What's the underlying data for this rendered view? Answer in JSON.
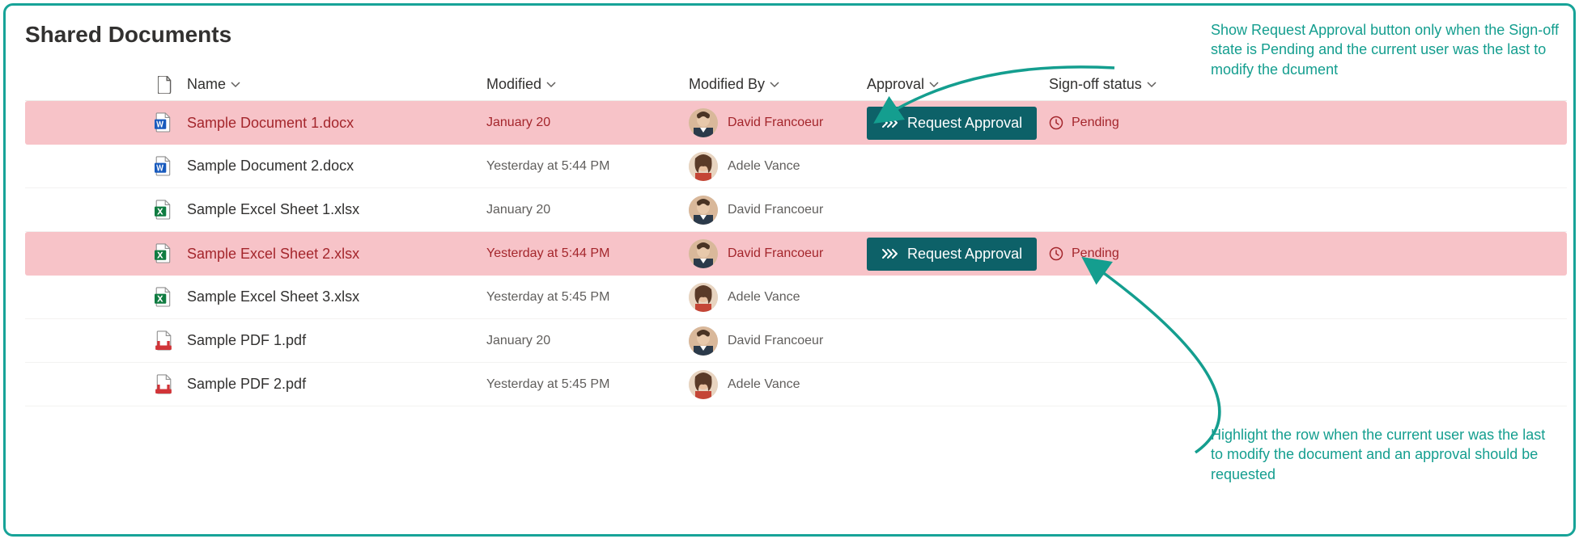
{
  "title": "Shared Documents",
  "columns": {
    "name": "Name",
    "modified": "Modified",
    "modified_by": "Modified By",
    "approval": "Approval",
    "sign_off": "Sign-off status"
  },
  "buttons": {
    "request_approval": "Request Approval"
  },
  "status_labels": {
    "pending": "Pending"
  },
  "annotations": {
    "top": "Show Request Approval button only when the Sign-off state is Pending and the current user was the last to modify the dcument",
    "bottom": "Highlight the row when the current user was the last to modify the document and an approval should be requested"
  },
  "rows": [
    {
      "file_type": "docx",
      "name": "Sample Document 1.docx",
      "modified": "January 20",
      "modified_by": "David Francoeur",
      "avatar": "david",
      "highlight": true,
      "show_approval_button": true,
      "sign_off": "pending"
    },
    {
      "file_type": "docx",
      "name": "Sample Document 2.docx",
      "modified": "Yesterday at 5:44 PM",
      "modified_by": "Adele Vance",
      "avatar": "adele",
      "highlight": false,
      "show_approval_button": false,
      "sign_off": null
    },
    {
      "file_type": "xlsx",
      "name": "Sample Excel Sheet 1.xlsx",
      "modified": "January 20",
      "modified_by": "David Francoeur",
      "avatar": "david",
      "highlight": false,
      "show_approval_button": false,
      "sign_off": null
    },
    {
      "file_type": "xlsx",
      "name": "Sample Excel Sheet 2.xlsx",
      "modified": "Yesterday at 5:44 PM",
      "modified_by": "David Francoeur",
      "avatar": "david",
      "highlight": true,
      "show_approval_button": true,
      "sign_off": "pending"
    },
    {
      "file_type": "xlsx",
      "name": "Sample Excel Sheet 3.xlsx",
      "modified": "Yesterday at 5:45 PM",
      "modified_by": "Adele Vance",
      "avatar": "adele",
      "highlight": false,
      "show_approval_button": false,
      "sign_off": null
    },
    {
      "file_type": "pdf",
      "name": "Sample PDF 1.pdf",
      "modified": "January 20",
      "modified_by": "David Francoeur",
      "avatar": "david",
      "highlight": false,
      "show_approval_button": false,
      "sign_off": null
    },
    {
      "file_type": "pdf",
      "name": "Sample PDF 2.pdf",
      "modified": "Yesterday at 5:45 PM",
      "modified_by": "Adele Vance",
      "avatar": "adele",
      "highlight": false,
      "show_approval_button": false,
      "sign_off": null
    }
  ],
  "colors": {
    "highlight_bg": "#f7c3c8",
    "highlight_text": "#a4262c",
    "primary_btn": "#0d6168",
    "teal": "#149e8f"
  }
}
